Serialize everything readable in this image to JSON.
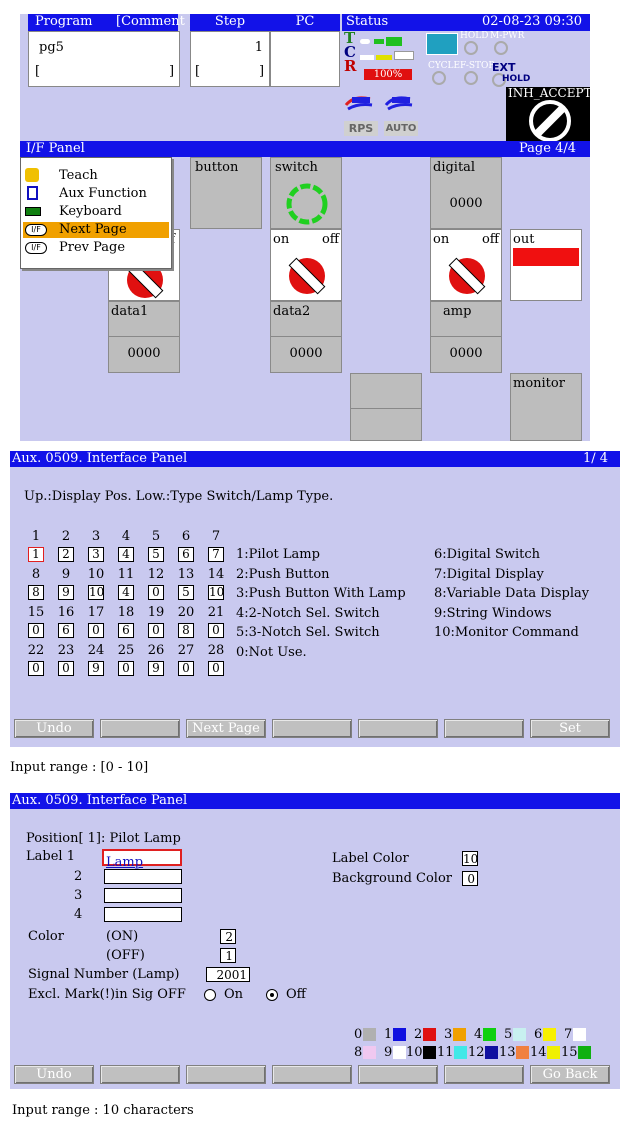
{
  "top": {
    "headers": {
      "program": "Program",
      "comment": "[Comment ]",
      "step": "Step",
      "pc": "PC",
      "status": "Status",
      "datetime": "02-08-23 09:30"
    },
    "program_name": "pg5",
    "program_bracket_l": "[",
    "program_bracket_r": "]",
    "step_value": "1",
    "step_bracket_l": "[",
    "step_bracket_r": "]",
    "status_letters": [
      "T",
      "C",
      "R"
    ],
    "r_percent": "100%",
    "status_small": {
      "hold": "HOLD",
      "mpwr": "M-PWR",
      "cycle": "CYCLE",
      "fstop": "F-STOP",
      "ext": "EXT",
      "hold2": "HOLD"
    },
    "rps": "RPS",
    "auto": "AUTO",
    "inh_accept": "INH_ACCEPT"
  },
  "if_panel": {
    "title": "I/F Panel",
    "page": "Page 4/4",
    "menu": [
      {
        "label": "Teach",
        "icon": "hand-icon"
      },
      {
        "label": "Aux Function",
        "icon": "document-icon"
      },
      {
        "label": "Keyboard",
        "icon": "keyboard-icon"
      },
      {
        "label": "Next Page",
        "icon": "if-icon"
      },
      {
        "label": "Prev Page",
        "icon": "if-icon"
      }
    ],
    "off1": "f",
    "tile_button": "button",
    "tile_switch": "switch",
    "tile_digital": "digital",
    "digital_value": "0000",
    "sw_on": "on",
    "sw_off": "off",
    "dg_on": "on",
    "dg_off": "off",
    "out": "out",
    "data1": "data1",
    "data1_value": "0000",
    "data2": "data2",
    "data2_value": "0000",
    "amp": "amp",
    "amp_value": "0000",
    "monitor": "monitor"
  },
  "aux1": {
    "title": "Aux.  0509. Interface Panel",
    "page": "1/  4",
    "heading": "Up.:Display Pos. Low.:Type  Switch/Lamp Type.",
    "rows": [
      {
        "pos": [
          "1",
          "2",
          "3",
          "4",
          "5",
          "6",
          "7"
        ],
        "types": [
          "1",
          "2",
          "3",
          "4",
          "5",
          "6",
          "7"
        ]
      },
      {
        "pos": [
          "8",
          "9",
          "10",
          "11",
          "12",
          "13",
          "14"
        ],
        "types": [
          "8",
          "9",
          "10",
          "4",
          "0",
          "5",
          "10"
        ]
      },
      {
        "pos": [
          "15",
          "16",
          "17",
          "18",
          "19",
          "20",
          "21"
        ],
        "types": [
          "0",
          "6",
          "0",
          "6",
          "0",
          "8",
          "0"
        ]
      },
      {
        "pos": [
          "22",
          "23",
          "24",
          "25",
          "26",
          "27",
          "28"
        ],
        "types": [
          "0",
          "0",
          "9",
          "0",
          "9",
          "0",
          "0"
        ]
      }
    ],
    "legend_left": [
      "1:Pilot Lamp",
      "2:Push Button",
      "3:Push Button With Lamp",
      "4:2-Notch Sel. Switch",
      "5:3-Notch Sel. Switch",
      "0:Not Use."
    ],
    "legend_right": [
      "6:Digital Switch",
      "7:Digital Display",
      "8:Variable Data Display",
      "9:String Windows",
      "10:Monitor Command"
    ],
    "buttons": [
      "Undo",
      "",
      "Next Page",
      "",
      "",
      "",
      "Set"
    ],
    "input_range": "Input range : [0  - 10]"
  },
  "aux2": {
    "title": "Aux.  0509. Interface Panel",
    "position": "Position[  1]: Pilot Lamp",
    "label1": "Label 1",
    "label_nums": [
      "2",
      "3",
      "4"
    ],
    "label1_value": "Lamp",
    "label_color": "Label Color",
    "label_color_value": "10",
    "bg_color": "Background Color",
    "bg_color_value": "0",
    "color": "Color",
    "on": "(ON)",
    "on_value": "2",
    "off": "(OFF)",
    "off_value": "1",
    "signal": "Signal Number (Lamp)",
    "signal_value": "2001",
    "excl": "Excl. Mark(!)in Sig OFF",
    "opt_on": "On",
    "opt_off": "Off",
    "palette": [
      {
        "n": "0",
        "c": "#b0b0b0"
      },
      {
        "n": "1",
        "c": "#1010e0"
      },
      {
        "n": "2",
        "c": "#e01010"
      },
      {
        "n": "3",
        "c": "#f0a000"
      },
      {
        "n": "4",
        "c": "#10d010"
      },
      {
        "n": "5",
        "c": "#c8f0f0"
      },
      {
        "n": "6",
        "c": "#f8f000"
      },
      {
        "n": "7",
        "c": "#ffffff"
      },
      {
        "n": "8",
        "c": "#f0c8f0"
      },
      {
        "n": "9",
        "c": "#ffffff"
      },
      {
        "n": "10",
        "c": "#000000"
      },
      {
        "n": "11",
        "c": "#40e8e8"
      },
      {
        "n": "12",
        "c": "#1010a0"
      },
      {
        "n": "13",
        "c": "#f08040"
      },
      {
        "n": "14",
        "c": "#f0f000"
      },
      {
        "n": "15",
        "c": "#10b010"
      }
    ],
    "buttons": [
      "Undo",
      "",
      "",
      "",
      "",
      "",
      "Go Back"
    ],
    "input_range": "Input range : 10 characters"
  }
}
